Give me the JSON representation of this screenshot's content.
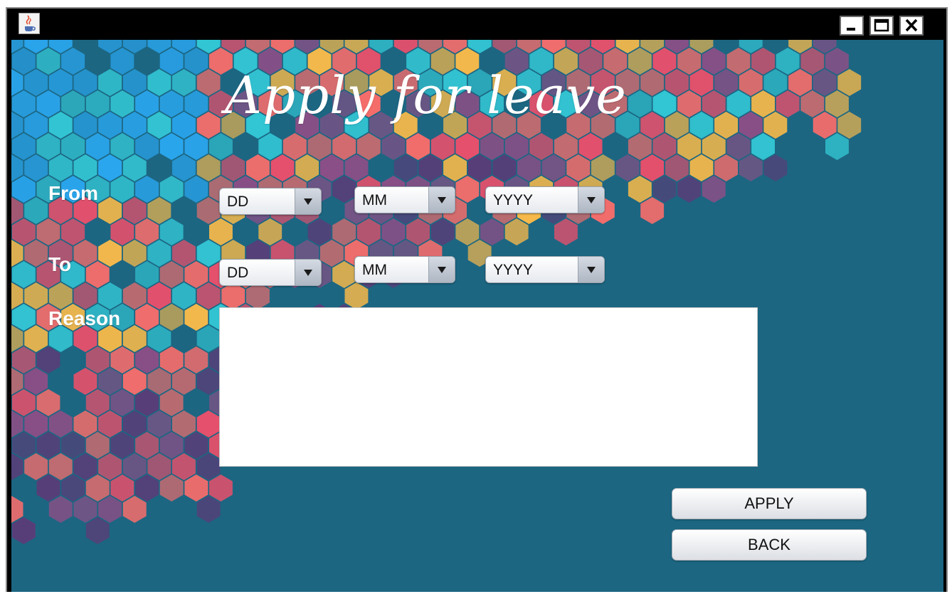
{
  "window": {
    "icons": {
      "app": "java-cup-icon",
      "minimize": "minimize-icon",
      "maximize": "maximize-icon",
      "close": "close-icon"
    }
  },
  "form": {
    "title": "Apply for leave",
    "from_label": "From",
    "to_label": "To",
    "reason_label": "Reason",
    "from": {
      "day": "DD",
      "month": "MM",
      "year": "YYYY"
    },
    "to": {
      "day": "DD",
      "month": "MM",
      "year": "YYYY"
    },
    "reason_value": ""
  },
  "actions": {
    "apply_label": "APPLY",
    "back_label": "BACK"
  },
  "colors": {
    "background": "#1c6682",
    "text": "#ffffff",
    "hex_palette": [
      "#2aa6ee",
      "#33c6d4",
      "#f6b94a",
      "#f46d6b",
      "#e8506b",
      "#8a4f86",
      "#5a3d78"
    ]
  }
}
